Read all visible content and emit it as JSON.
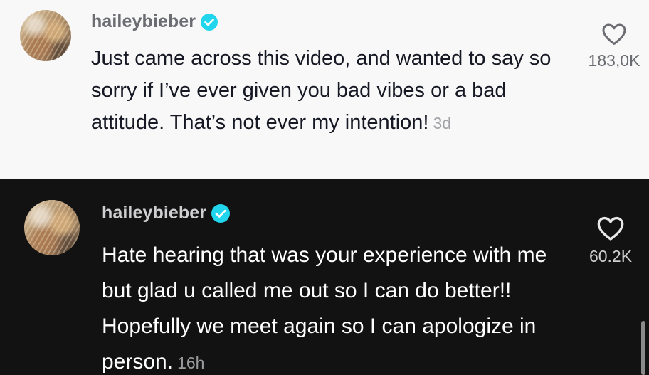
{
  "comments": [
    {
      "username": "haileybieber",
      "verified": true,
      "text": "Just came across this video, and wanted to say so sorry if I’ve ever given you bad vibes or a bad attitude. That’s not ever my intention!",
      "age": "3d",
      "likes": "183,0K",
      "theme": "light"
    },
    {
      "username": "haileybieber",
      "verified": true,
      "text": "Hate hearing that was your experience with me but glad u called me out so I can do better!! Hopefully we meet again so I can apologize in person.",
      "age": "16h",
      "likes": "60.2K",
      "theme": "dark"
    }
  ],
  "colors": {
    "verified_badge": "#20d5ec",
    "light_background": "#f8f8f8",
    "dark_background": "#121212"
  },
  "icons": [
    "heart-outline-icon",
    "verified-badge-icon"
  ]
}
